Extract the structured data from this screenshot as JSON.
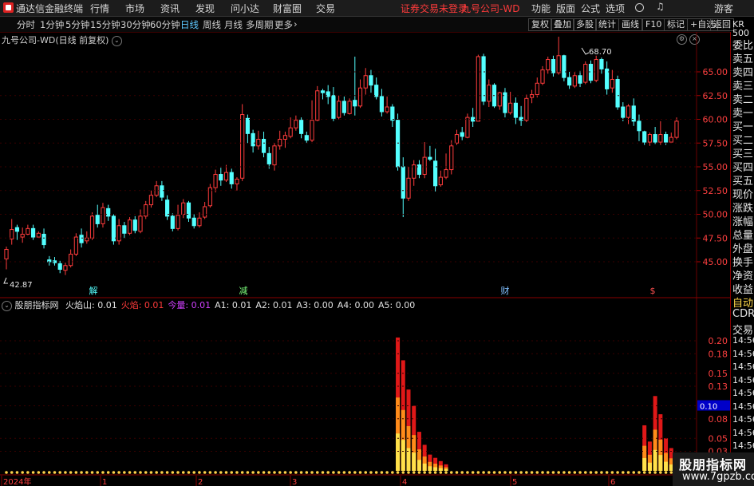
{
  "menubar": {
    "app_title": "通达信金融终端",
    "items": [
      "行情",
      "市场",
      "资讯",
      "发现",
      "问小达",
      "财富圈",
      "交易"
    ],
    "status": "证券交易未登录",
    "stock": "九号公司-WD",
    "right_items": [
      "功能",
      "版面",
      "公式",
      "选项"
    ],
    "user": "游客"
  },
  "toolbar": {
    "periods": [
      "分时",
      "1分钟",
      "5分钟",
      "15分钟",
      "30分钟",
      "60分钟",
      "日线",
      "周线",
      "月线",
      "多周期",
      "更多"
    ],
    "active": "日线",
    "right_buttons": [
      "复权",
      "叠加",
      "多股",
      "统计",
      "画线",
      "F10",
      "标记",
      "+自选",
      "返回"
    ]
  },
  "chart_info": {
    "stock_label": "九号公司-WD(日线 前复权)"
  },
  "price_chart": {
    "high_label": "68.70",
    "low_label": "42.87",
    "y_ticks": [
      "65.00",
      "62.50",
      "60.00",
      "57.50",
      "55.00",
      "52.50",
      "50.00",
      "47.50",
      "45.00"
    ],
    "events": [
      "解",
      "减",
      "财",
      "$"
    ],
    "colors": {
      "up": "#ff3c3c",
      "down": "#54ffff",
      "grid": "#3a0000"
    }
  },
  "indicator": {
    "name": "股朋指标网",
    "items": [
      {
        "label": "火焰山:",
        "value": "0.01",
        "color": "#e0e0e0"
      },
      {
        "label": "火焰:",
        "value": "0.01",
        "color": "#ff3b3b"
      },
      {
        "label": "今量:",
        "value": "0.01",
        "color": "#d040ff"
      },
      {
        "label": "A1:",
        "value": "0.01",
        "color": "#e0e0e0"
      },
      {
        "label": "A2:",
        "value": "0.01",
        "color": "#e0e0e0"
      },
      {
        "label": "A3:",
        "value": "0.00",
        "color": "#e0e0e0"
      },
      {
        "label": "A4:",
        "value": "0.00",
        "color": "#e0e0e0"
      },
      {
        "label": "A5:",
        "value": "0.00",
        "color": "#e0e0e0"
      }
    ],
    "y_ticks": [
      "0.20",
      "0.18",
      "0.15",
      "0.13",
      "0.10",
      "0.08",
      "0.05",
      "0.03"
    ],
    "current_value": "0.10"
  },
  "x_axis": {
    "labels": [
      "2024年",
      "1",
      "2",
      "3",
      "4",
      "5",
      "6"
    ]
  },
  "right_panel": {
    "top": "KR",
    "top2": "500",
    "items": [
      "委比",
      "卖五",
      "卖四",
      "卖三",
      "卖二",
      "卖一",
      "买一",
      "买二",
      "买三",
      "买四",
      "买五",
      "现价",
      "涨跌",
      "涨幅",
      "总量",
      "外盘",
      "换手",
      "净资",
      "收益",
      "自动",
      "CDR",
      "交易",
      "14:56",
      "14:56",
      "14:56",
      "14:56",
      "14:56",
      "14:56",
      "14:56",
      "14:56",
      "14:56"
    ]
  },
  "watermark": {
    "line1": "股朋指标网",
    "line2": "www.7gpzb.com"
  }
}
